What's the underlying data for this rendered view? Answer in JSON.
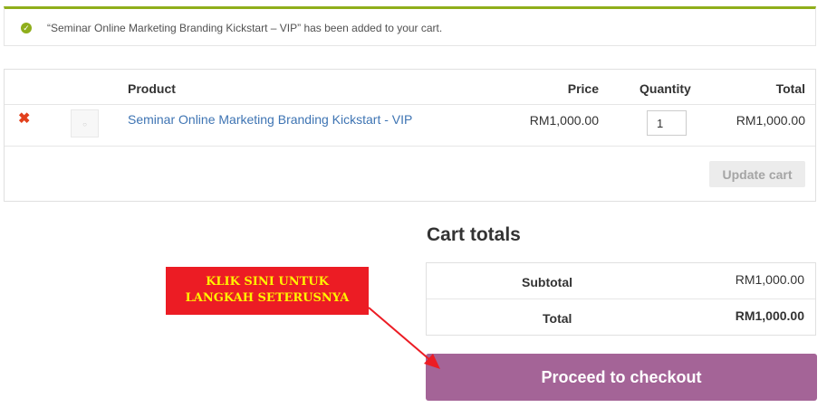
{
  "notice": {
    "icon": "check-circle-icon",
    "color": "#8fae1b",
    "message": "“Seminar Online Marketing Branding Kickstart – VIP” has been added to your cart."
  },
  "cart": {
    "headers": {
      "product": "Product",
      "price": "Price",
      "quantity": "Quantity",
      "total": "Total"
    },
    "items": [
      {
        "remove_icon": "remove-x-icon",
        "thumbnail_icon": "placeholder-image-icon",
        "name": "Seminar Online Marketing Branding Kickstart - VIP",
        "price": "RM1,000.00",
        "quantity": "1",
        "total": "RM1,000.00"
      }
    ],
    "update_button": "Update cart"
  },
  "totals": {
    "title": "Cart totals",
    "subtotal_label": "Subtotal",
    "subtotal_value": "RM1,000.00",
    "total_label": "Total",
    "total_value": "RM1,000.00"
  },
  "checkout_button": "Proceed to checkout",
  "callout": {
    "line1": "KLIK SINI UNTUK",
    "line2": "LANGKAH SETERUSNYA",
    "bg_color": "#ec1c24",
    "text_color": "#fff200"
  },
  "colors": {
    "accent": "#a46497",
    "link": "#3e74b3",
    "remove": "#e2401c"
  }
}
